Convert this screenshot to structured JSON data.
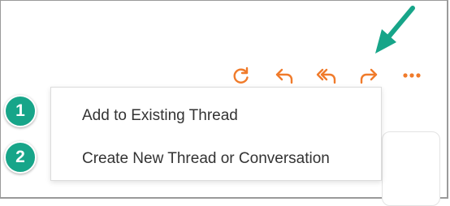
{
  "toolbar": {
    "icons": [
      "refresh-icon",
      "reply-icon",
      "reply-all-icon",
      "forward-icon",
      "more-icon"
    ]
  },
  "menu": {
    "items": [
      {
        "label": "Add to Existing Thread"
      },
      {
        "label": "Create New Thread or Conversation"
      }
    ]
  },
  "badges": [
    "1",
    "2"
  ],
  "colors": {
    "toolbar_icon": "#f07b2b",
    "badge": "#17a589",
    "arrow": "#17a589",
    "menu_text": "#333333",
    "frame_border": "#9a9a9a"
  }
}
